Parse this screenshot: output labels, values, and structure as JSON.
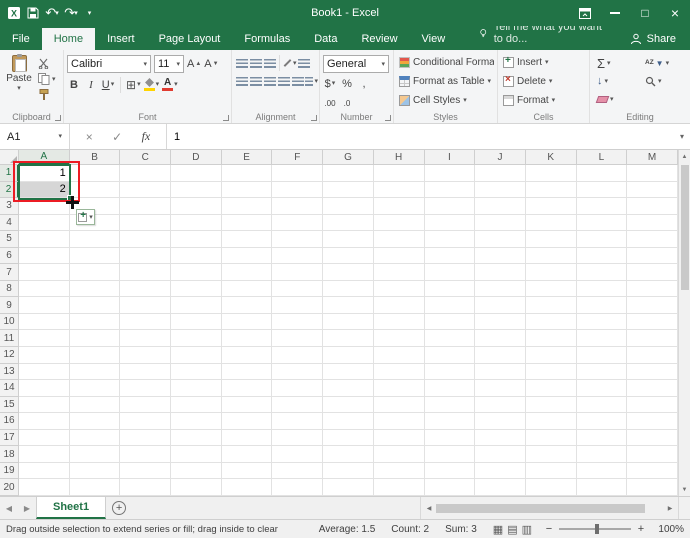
{
  "icons": {
    "caret": "▾",
    "up": "▲",
    "down": "▼",
    "left": "◀",
    "right": "▶",
    "undo": "↶",
    "redo": "↷",
    "maximize": "□",
    "close": "×",
    "cancel": "×",
    "check": "✓",
    "sigma": "Σ",
    "plus": "+",
    "fill_down": "↓",
    "borders": "⊞",
    "view_normal": "▦",
    "view_layout": "▤",
    "view_break": "▥"
  },
  "title_bar": {
    "title": "Book1 - Excel"
  },
  "ribbon_tabs": {
    "file": "File",
    "tabs": [
      "Home",
      "Insert",
      "Page Layout",
      "Formulas",
      "Data",
      "Review",
      "View"
    ],
    "active": "Home",
    "tell_me": "Tell me what you want to do...",
    "share": "Share"
  },
  "ribbon": {
    "clipboard": {
      "paste": "Paste",
      "label": "Clipboard"
    },
    "font": {
      "family": "Calibri",
      "size": "11",
      "bold": "B",
      "italic": "I",
      "underline": "U",
      "label": "Font"
    },
    "alignment": {
      "label": "Alignment"
    },
    "number": {
      "format": "General",
      "currency": "$",
      "percent": "%",
      "comma": ",",
      "increase_decimal": ".00",
      "decrease_decimal": ".0",
      "label": "Number"
    },
    "styles": {
      "items": [
        "Conditional Formatting",
        "Format as Table",
        "Cell Styles"
      ],
      "label": "Styles"
    },
    "cells": {
      "items": [
        "Insert",
        "Delete",
        "Format"
      ],
      "label": "Cells"
    },
    "editing": {
      "sort_az": "AZ",
      "label": "Editing"
    }
  },
  "formula_bar": {
    "name_box": "A1",
    "fx": "fx",
    "value": "1"
  },
  "grid": {
    "columns": [
      "A",
      "B",
      "C",
      "D",
      "E",
      "F",
      "G",
      "H",
      "I",
      "J",
      "K",
      "L",
      "M"
    ],
    "row_count": 20,
    "selected_columns": [
      "A"
    ],
    "selected_rows": [
      1,
      2
    ],
    "selection": "A1:A2",
    "active_cell": "A1",
    "cells": [
      {
        "ref": "A1",
        "value": "1",
        "state": "active"
      },
      {
        "ref": "A2",
        "value": "2",
        "state": "selected"
      }
    ]
  },
  "sheet_tabs": {
    "tabs": [
      {
        "name": "Sheet1",
        "active": true
      }
    ]
  },
  "status_bar": {
    "message": "Drag outside selection to extend series or fill; drag inside to clear",
    "average": "Average: 1.5",
    "count": "Count: 2",
    "sum": "Sum: 3",
    "zoom_out": "−",
    "zoom_in": "+",
    "zoom": "100%"
  }
}
